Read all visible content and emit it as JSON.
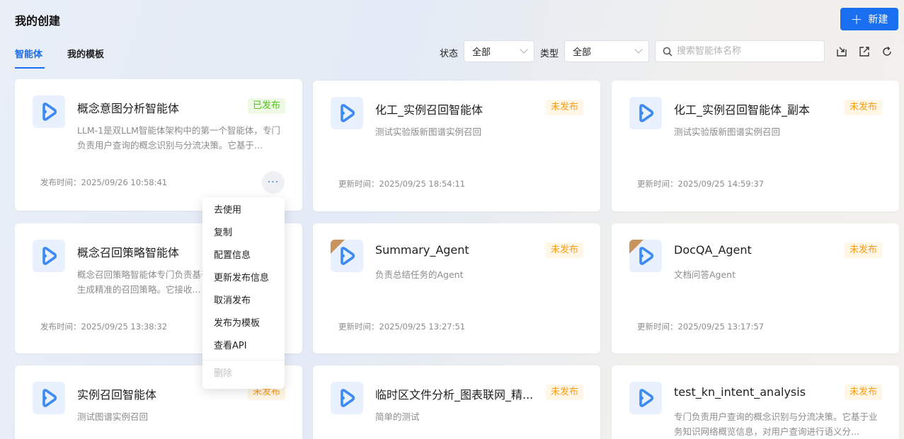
{
  "header": {
    "title": "我的创建",
    "new_button": "新建"
  },
  "tabs": [
    {
      "label": "智能体",
      "active": true
    },
    {
      "label": "我的模板",
      "active": false
    }
  ],
  "filters": {
    "status_label": "状态",
    "status_value": "全部",
    "type_label": "类型",
    "type_value": "全部",
    "search_placeholder": "搜索智能体名称"
  },
  "toolbar_icons": [
    "import-icon",
    "export-icon",
    "refresh-icon"
  ],
  "colors": {
    "accent": "#1a6ef0",
    "published": "#52c41a",
    "unpublished": "#fa9d16"
  },
  "cards": [
    {
      "name": "概念意图分析智能体",
      "status": "已发布",
      "desc": "LLM-1是双LLM智能体架构中的第一个智能体，专门负责用户查询的概念识别与分流决策。它基于...",
      "time": "发布时间：2025/09/26 10:58:41",
      "template": false
    },
    {
      "name": "化工_实例召回智能体",
      "status": "未发布",
      "desc": "测试实验版新图谱实例召回",
      "time": "更新时间：2025/09/25 18:54:11",
      "template": false
    },
    {
      "name": "化工_实例召回智能体_副本",
      "status": "未发布",
      "desc": "测试实验版新图谱实例召回",
      "time": "更新时间：2025/09/25 14:59:37",
      "template": false
    },
    {
      "name": "概念召回策略智能体",
      "status": "",
      "desc": "概念召回策略智能体专门负责基于概念意图分析结果生成精准的召回策略。它接收...",
      "time": "发布时间：2025/09/25 13:38:32",
      "template": false
    },
    {
      "name": "Summary_Agent",
      "status": "未发布",
      "desc": "负责总结任务的Agent",
      "time": "更新时间：2025/09/25 13:27:51",
      "template": true
    },
    {
      "name": "DocQA_Agent",
      "status": "未发布",
      "desc": "文档问答Agent",
      "time": "更新时间：2025/09/25 13:17:57",
      "template": true
    },
    {
      "name": "实例召回智能体",
      "status": "未发布",
      "desc": "测试图谱实例召回",
      "time": "",
      "template": false
    },
    {
      "name": "临时区文件分析_图表联网_精...",
      "status": "未发布",
      "desc": "简单的测试",
      "time": "",
      "template": false
    },
    {
      "name": "test_kn_intent_analysis",
      "status": "未发布",
      "desc": "专门负责用户查询的概念识别与分流决策。它基于业务知识网络概览信息，对用户查询进行语义分...",
      "time": "",
      "template": false
    }
  ],
  "more_button": "···",
  "menu": {
    "items": [
      "去使用",
      "复制",
      "配置信息",
      "更新发布信息",
      "取消发布",
      "发布为模板",
      "查看API"
    ],
    "disabled_item": "删除"
  }
}
